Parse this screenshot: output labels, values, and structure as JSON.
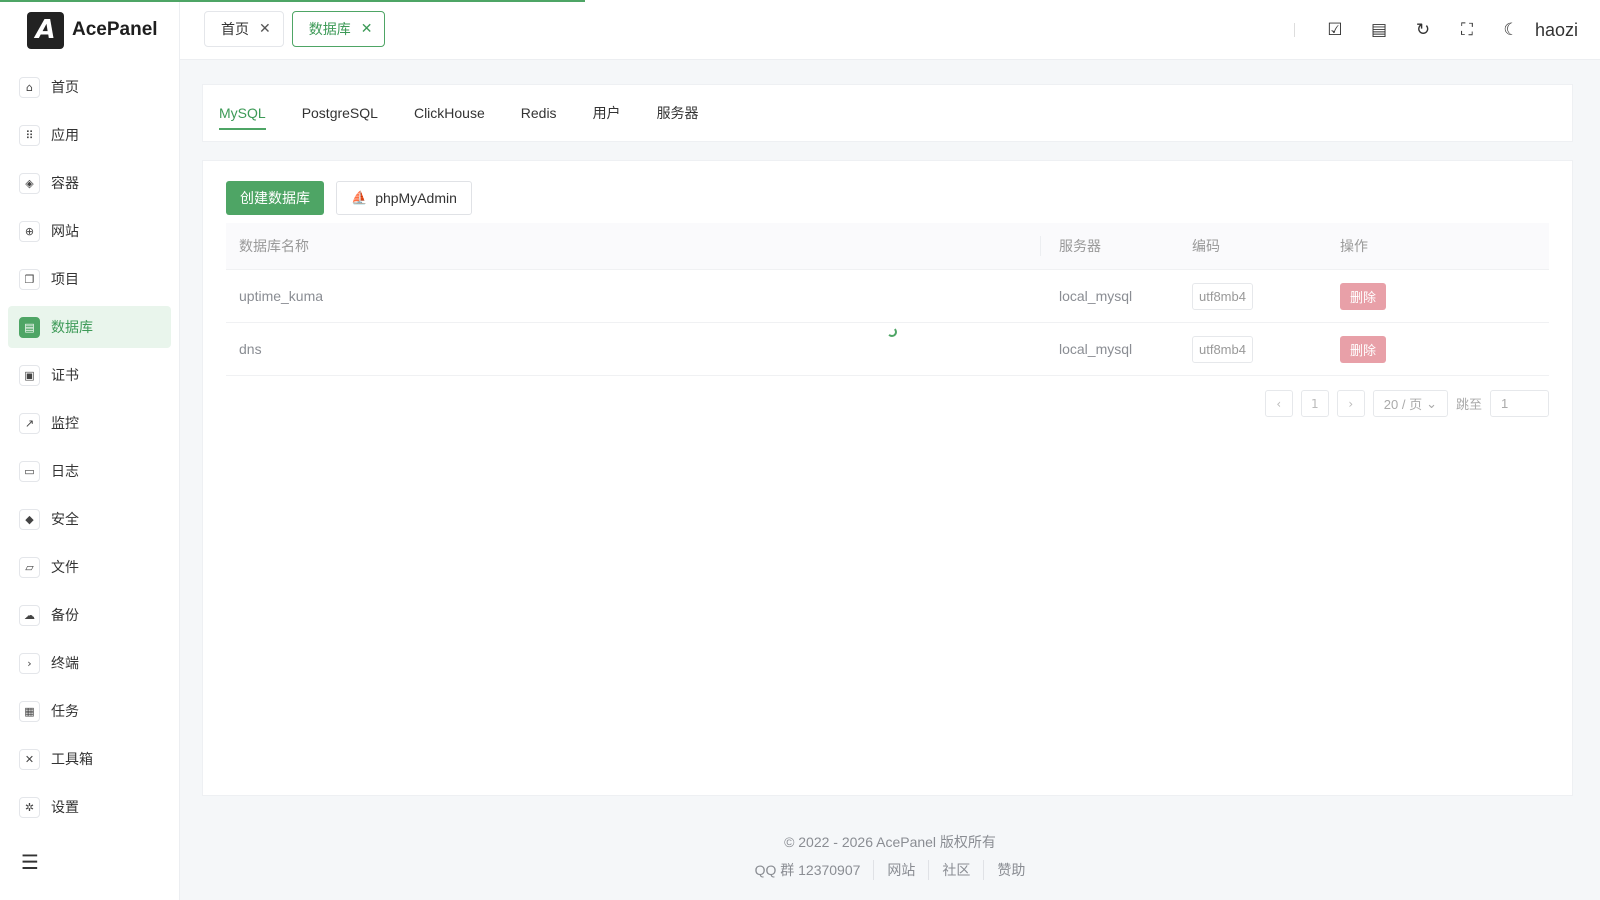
{
  "brand": {
    "logo_text": "AcePanel",
    "logo_letter": "A"
  },
  "sidebar": {
    "items": [
      {
        "label": "首页",
        "icon": "⌂",
        "name": "home"
      },
      {
        "label": "应用",
        "icon": "⠿",
        "name": "apps"
      },
      {
        "label": "容器",
        "icon": "◈",
        "name": "container"
      },
      {
        "label": "网站",
        "icon": "⊕",
        "name": "website"
      },
      {
        "label": "项目",
        "icon": "❐",
        "name": "project"
      },
      {
        "label": "数据库",
        "icon": "▤",
        "name": "database",
        "active": true
      },
      {
        "label": "证书",
        "icon": "▣",
        "name": "certificate"
      },
      {
        "label": "监控",
        "icon": "↗",
        "name": "monitor"
      },
      {
        "label": "日志",
        "icon": "▭",
        "name": "logs"
      },
      {
        "label": "安全",
        "icon": "◆",
        "name": "security"
      },
      {
        "label": "文件",
        "icon": "▱",
        "name": "files"
      },
      {
        "label": "备份",
        "icon": "☁",
        "name": "backup"
      },
      {
        "label": "终端",
        "icon": "›",
        "name": "terminal"
      },
      {
        "label": "任务",
        "icon": "▦",
        "name": "tasks"
      },
      {
        "label": "工具箱",
        "icon": "✕",
        "name": "toolbox"
      },
      {
        "label": "设置",
        "icon": "✲",
        "name": "settings"
      }
    ],
    "collapse_icon": "☰"
  },
  "header": {
    "tabs": [
      {
        "label": "首页",
        "active": false
      },
      {
        "label": "数据库",
        "active": true
      }
    ],
    "close_glyph": "✕",
    "icons": {
      "task": "☑",
      "notes": "▤",
      "refresh": "↻",
      "fullscreen": "⛶",
      "theme": "☾"
    },
    "username": "haozi"
  },
  "db_tabs": [
    {
      "label": "MySQL",
      "active": true
    },
    {
      "label": "PostgreSQL",
      "active": false
    },
    {
      "label": "ClickHouse",
      "active": false
    },
    {
      "label": "Redis",
      "active": false
    },
    {
      "label": "用户",
      "active": false
    },
    {
      "label": "服务器",
      "active": false
    }
  ],
  "actions": {
    "create_label": "创建数据库",
    "phpmyadmin_label": "phpMyAdmin",
    "phpmyadmin_icon": "⛵"
  },
  "table": {
    "headers": {
      "name": "数据库名称",
      "server": "服务器",
      "encoding": "编码",
      "operation": "操作"
    },
    "rows": [
      {
        "name": "uptime_kuma",
        "server": "local_mysql",
        "encoding": "utf8mb4",
        "action": "删除"
      },
      {
        "name": "dns",
        "server": "local_mysql",
        "encoding": "utf8mb4",
        "action": "删除"
      }
    ]
  },
  "pagination": {
    "prev": "‹",
    "page": "1",
    "next": "›",
    "page_size": "20 / 页",
    "page_size_chevron": "⌄",
    "jump_label": "跳至",
    "jump_value": "1"
  },
  "footer": {
    "copyright": "© 2022 - 2026 AcePanel 版权所有",
    "links": [
      "QQ 群 12370907",
      "网站",
      "社区",
      "赞助"
    ]
  },
  "colors": {
    "accent": "#4ea565",
    "danger_disabled": "#e8a0a8",
    "active_bg": "#e9f5ec"
  }
}
